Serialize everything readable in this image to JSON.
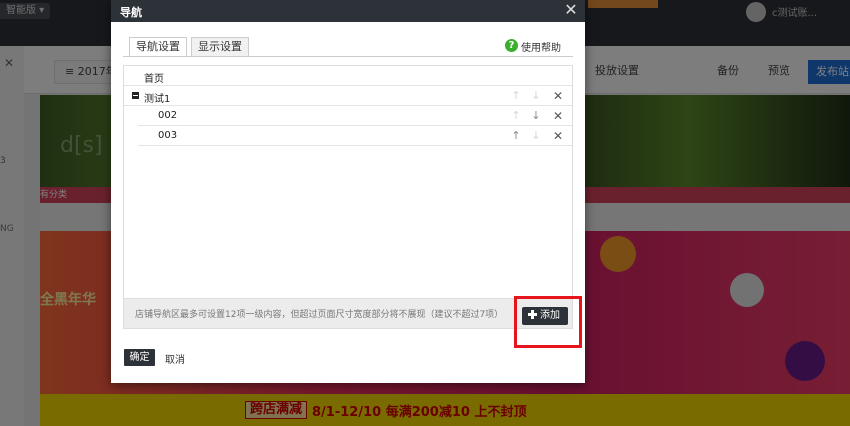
{
  "background": {
    "edition_label": "智能版",
    "username": "c测试账...",
    "toolbar": {
      "year_button": "2017年",
      "ad_settings": "投放设置",
      "backup": "备份",
      "preview": "预览",
      "publish": "发布站点"
    },
    "banner_text": "d[s]",
    "category_bar": "有分类",
    "promo_title": "全黑年华",
    "footer_tag": "跨店满减",
    "footer_offer": "8/1-12/10 每满200减10 上不封顶",
    "left_fragment_1": "3",
    "left_fragment_2": "NG"
  },
  "modal": {
    "title": "导航",
    "close_glyph": "✕",
    "tabs": [
      {
        "label": "导航设置",
        "active": true
      },
      {
        "label": "显示设置",
        "active": false
      }
    ],
    "help": {
      "icon_glyph": "?",
      "label": "使用帮助"
    },
    "nav_items": [
      {
        "label": "首页",
        "level": 0,
        "expandable": false,
        "show_controls": false
      },
      {
        "label": "测试1",
        "level": 0,
        "expandable": true,
        "show_controls": true,
        "up_enabled": false,
        "down_enabled": false
      },
      {
        "label": "002",
        "level": 1,
        "expandable": false,
        "show_controls": true,
        "up_enabled": false,
        "down_enabled": true
      },
      {
        "label": "003",
        "level": 1,
        "expandable": false,
        "show_controls": true,
        "up_enabled": true,
        "down_enabled": false
      }
    ],
    "control_glyphs": {
      "up": "↑",
      "down": "↓",
      "remove": "✕"
    },
    "footer_note": "店铺导航区最多可设置12项一级内容，但超过页面尺寸宽度部分将不展现（建议不超过7项）",
    "add_button": "添加",
    "confirm_button": "确定",
    "cancel_button": "取消"
  },
  "colors": {
    "header_dark": "#2d3138",
    "help_green": "#3cae2e",
    "highlight_red": "#e8141b",
    "publish_blue": "#1f6fd6"
  }
}
